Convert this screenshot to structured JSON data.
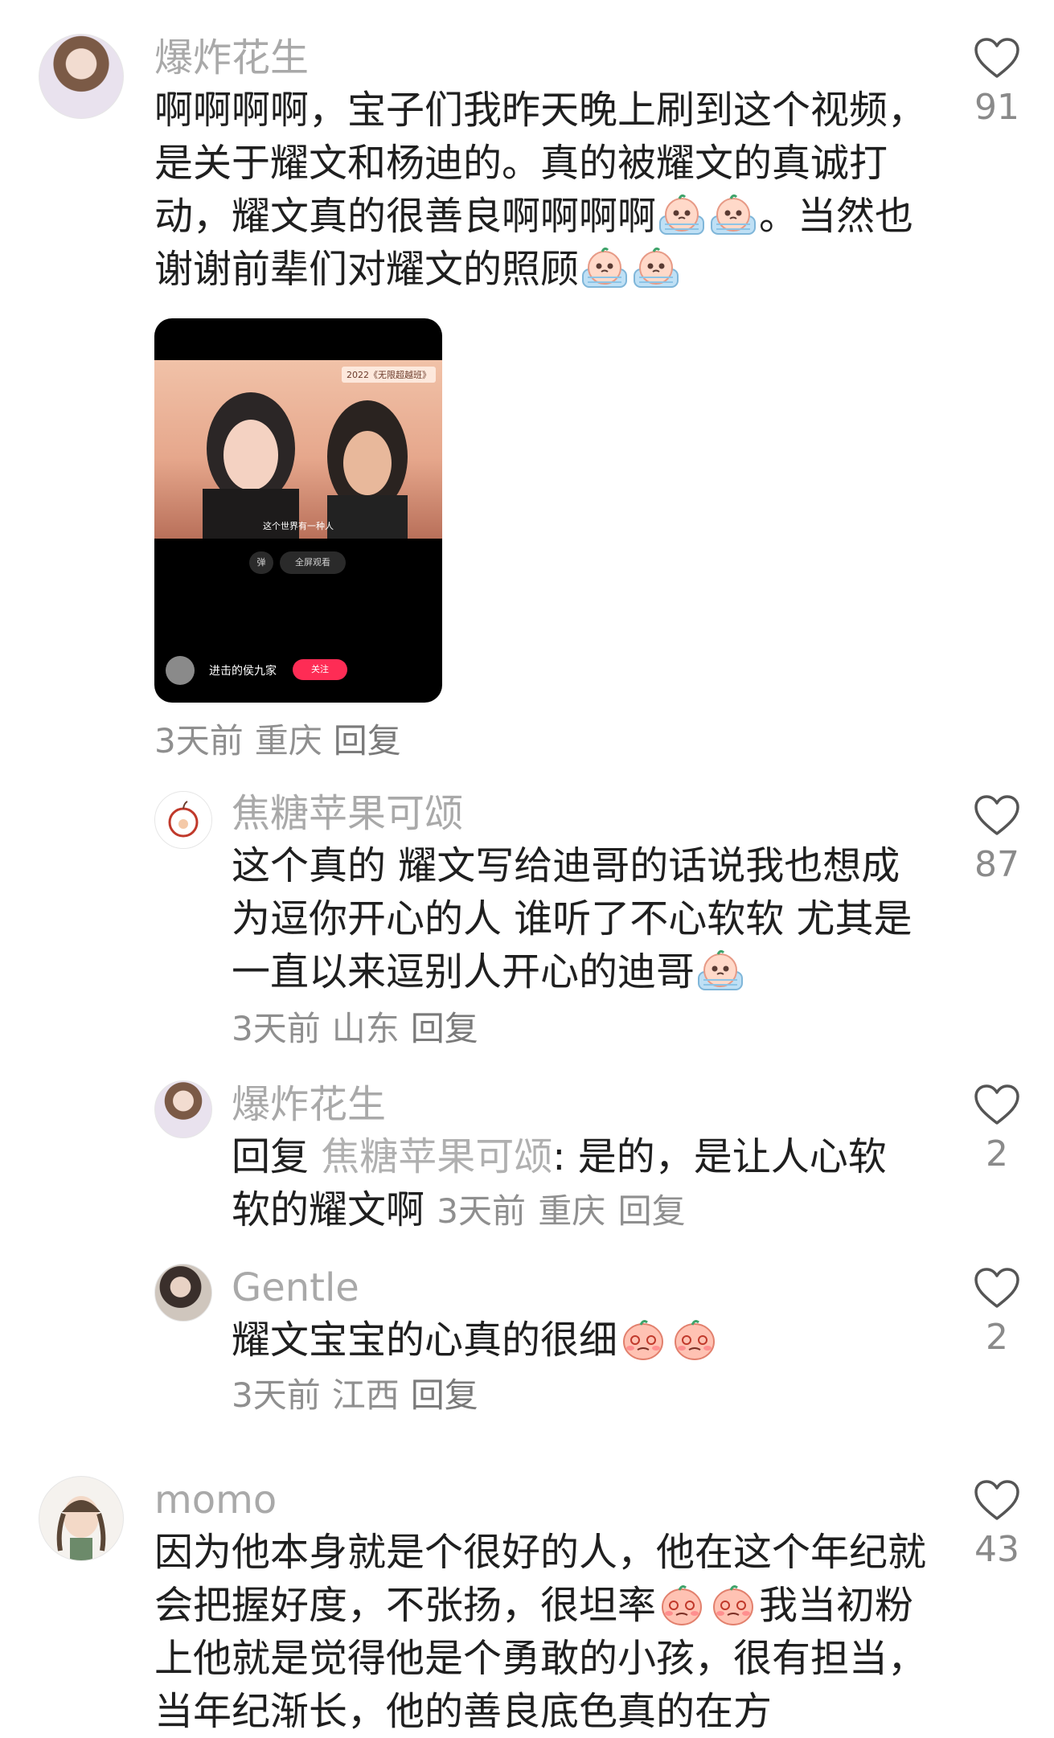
{
  "comments": [
    {
      "username": "爆炸花生",
      "text_parts": [
        "啊啊啊啊，宝子们我昨天晚上刷到这个视频，是关于耀文和杨迪的。真的被耀文的真诚打动，耀文真的很善良啊啊啊啊",
        "。当然也谢谢前辈们对耀文的照顾"
      ],
      "video": {
        "tag": "2022《无限超越班》",
        "subtitle": "这个世界有一种人",
        "pill_left": "弹",
        "pill_right": "全屏观看",
        "uploader": "进击的侯九家",
        "follow": "关注"
      },
      "meta": {
        "time": "3天前",
        "location": "重庆",
        "reply": "回复"
      },
      "likes": "91"
    },
    {
      "username": "焦糖苹果可颂",
      "text": "这个真的 耀文写给迪哥的话说我也想成为逗你开心的人 谁听了不心软软 尤其是一直以来逗别人开心的迪哥",
      "meta": {
        "time": "3天前",
        "location": "山东",
        "reply": "回复"
      },
      "likes": "87"
    },
    {
      "username": "爆炸花生",
      "reply_label": "回复",
      "reply_to": "焦糖苹果可颂",
      "text": ": 是的，是让人心软软的耀文啊",
      "meta": {
        "time": "3天前",
        "location": "重庆",
        "reply": "回复"
      },
      "likes": "2"
    },
    {
      "username": "Gentle",
      "text": "耀文宝宝的心真的很细",
      "meta": {
        "time": "3天前",
        "location": "江西",
        "reply": "回复"
      },
      "likes": "2"
    },
    {
      "username": "momo",
      "text_parts": [
        "因为他本身就是个很好的人，他在这个年纪就会把握好度，不张扬，很坦率",
        "我当初粉上他就是觉得他是个勇敢的小孩，很有担当，当年纪渐长，他的善良底色真的在方"
      ],
      "likes": "43"
    }
  ],
  "colors": {
    "username": "#a9a9a9",
    "meta": "#8f8f8f",
    "text": "#1f1f1f",
    "follow": "#fe2c55"
  },
  "icons": [
    "heart-outline-icon",
    "crying-peach-emoji",
    "shy-peach-emoji"
  ]
}
